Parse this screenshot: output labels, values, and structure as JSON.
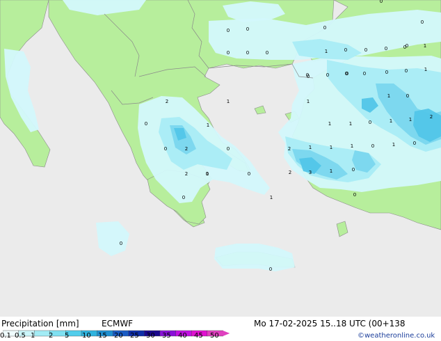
{
  "title": {
    "parameter": "Precipitation [mm]",
    "model": "ECMWF",
    "valid_time": "Mo 17-02-2025 15..18 UTC (00+138",
    "credit": "©weatheronline.co.uk"
  },
  "legend": {
    "labels": [
      "0.1",
      "0.5",
      "1",
      "2",
      "5",
      "10",
      "15",
      "20",
      "25",
      "30",
      "35",
      "40",
      "45",
      "50"
    ],
    "colors": [
      "#f0fcfe",
      "#ccf6fb",
      "#a3ecf5",
      "#7fe0f1",
      "#52cdeb",
      "#2fb3de",
      "#1f8fd0",
      "#1a5cc4",
      "#0e2ea8",
      "#1a078c",
      "#8a10d8",
      "#c010e0",
      "#e010d0",
      "#e040c0"
    ]
  },
  "colors": {
    "sea": "#ebebeb",
    "land": "#b7ee9c",
    "precip_light": "#d3f8fc",
    "precip_mid": "#a9ecf6",
    "precip_heavy": "#7ad7ee",
    "precip_peak": "#52c6e8",
    "border": "#8a8a8a"
  },
  "map": {
    "values": [
      "0",
      "0",
      "0",
      "0",
      "0",
      "0",
      "0",
      "0",
      "0",
      "0",
      "0",
      "0",
      "1",
      "0",
      "0",
      "0",
      "0",
      "1",
      "0",
      "0",
      "0",
      "0",
      "0",
      "1",
      "2",
      "1",
      "1",
      "0",
      "1",
      "1",
      "0",
      "1",
      "1",
      "2",
      "1",
      "0",
      "1",
      "2",
      "0",
      "2",
      "1",
      "1",
      "1",
      "0",
      "1",
      "0",
      "2",
      "0",
      "0",
      "0",
      "3",
      "1",
      "0",
      "2",
      "0",
      "0",
      "0",
      "0",
      "1",
      "1"
    ]
  }
}
